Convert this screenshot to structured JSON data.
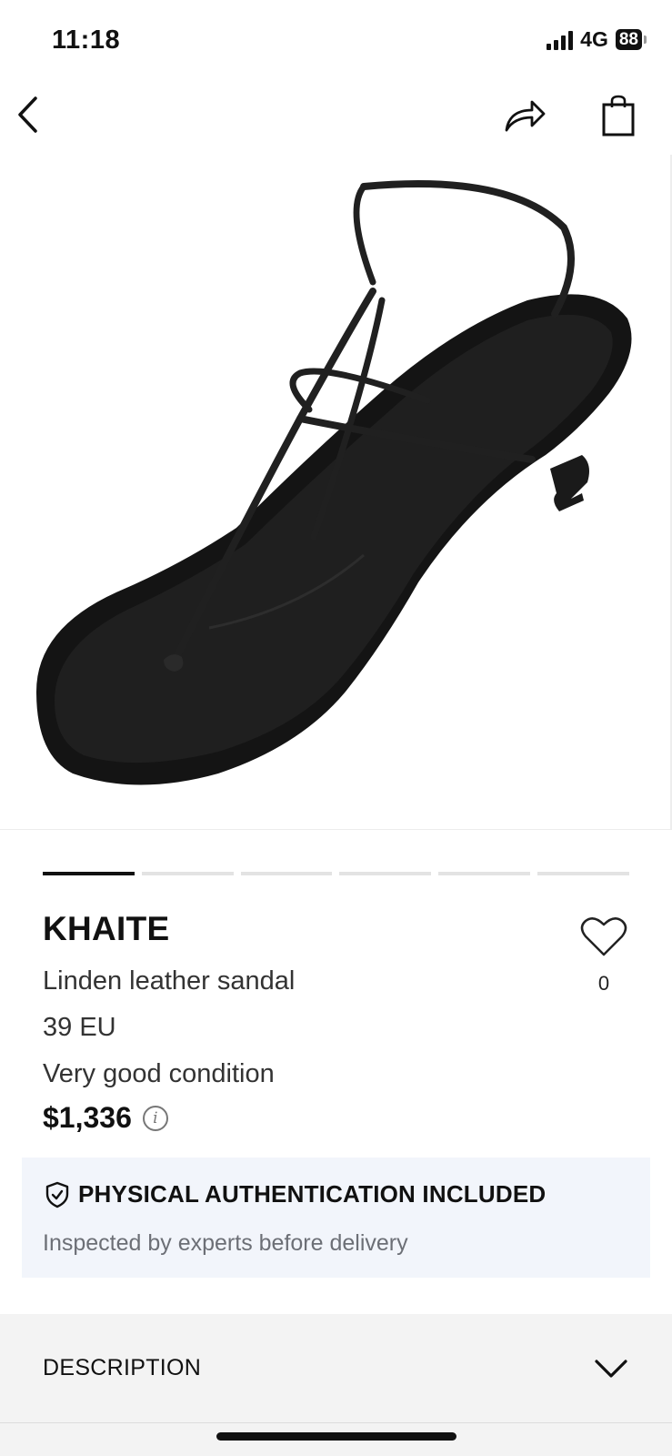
{
  "status_bar": {
    "time": "11:18",
    "network": "4G",
    "battery": "88"
  },
  "nav": {
    "back_icon": "chevron-left-icon",
    "share_icon": "share-arrow-icon",
    "bag_icon": "shopping-bag-icon"
  },
  "gallery": {
    "total_images": 6,
    "active_index": 0
  },
  "product": {
    "brand": "KHAITE",
    "name": "Linden leather sandal",
    "size": "39 EU",
    "condition": "Very good condition",
    "price": "$1,336",
    "likes": "0"
  },
  "authentication": {
    "title": "PHYSICAL AUTHENTICATION INCLUDED",
    "subtitle": "Inspected by experts before delivery",
    "icon": "shield-check-icon"
  },
  "description": {
    "label": "DESCRIPTION"
  },
  "colors": {
    "auth_bg": "#f2f5fb",
    "section_bg": "#f3f3f3",
    "text": "#111111"
  }
}
